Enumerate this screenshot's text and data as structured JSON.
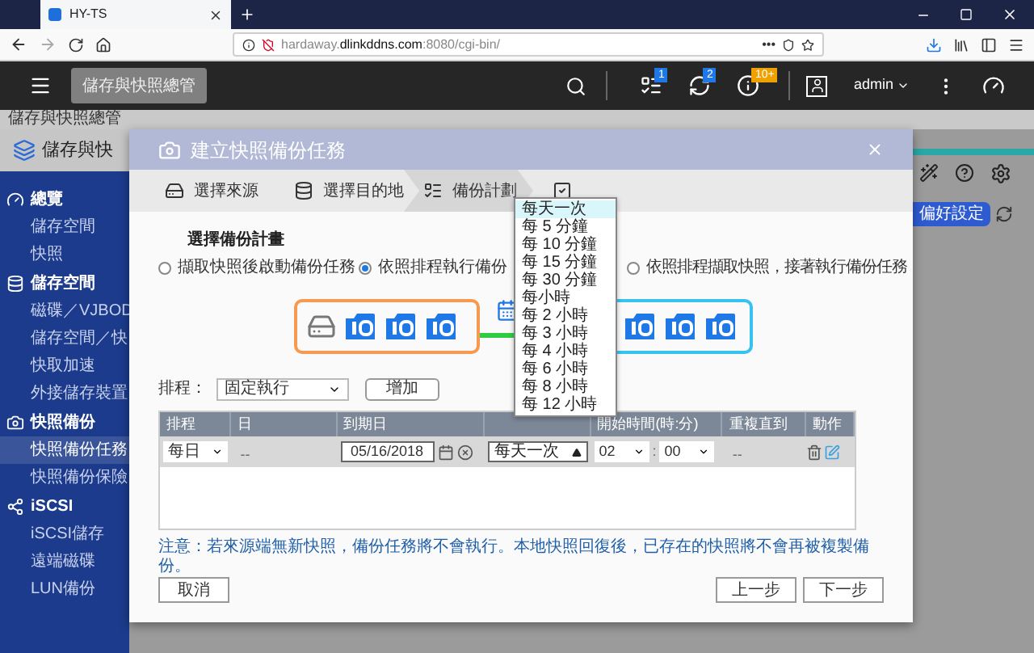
{
  "browser": {
    "tab": {
      "title": "HY-TS"
    },
    "url": {
      "prefix": "hardaway.",
      "host": "dlinkddns.com",
      "suffix": ":8080/cgi-bin/"
    },
    "page_actions": "•••"
  },
  "app_bar": {
    "app_tab": "儲存與快照總管",
    "badges": [
      {
        "text": "1",
        "color": "#1e78e6"
      },
      {
        "text": "2",
        "color": "#1e78e6"
      },
      {
        "text": "10+",
        "color": "#f0a000"
      }
    ],
    "user": "admin"
  },
  "breadcrumb": "儲存與快照總管",
  "sidebar": {
    "header": "儲存與快",
    "groups": [
      {
        "label": "總覽",
        "items": [
          {
            "label": "儲存空間",
            "selected": false
          },
          {
            "label": "快照",
            "selected": false
          }
        ]
      },
      {
        "label": "儲存空間",
        "items": [
          {
            "label": "磁碟／VJBOD",
            "selected": false
          },
          {
            "label": "儲存空間／快",
            "selected": false
          },
          {
            "label": "快取加速",
            "selected": false
          },
          {
            "label": "外接儲存裝置",
            "selected": false
          }
        ]
      },
      {
        "label": "快照備份",
        "items": [
          {
            "label": "快照備份任務",
            "selected": true
          },
          {
            "label": "快照備份保險",
            "selected": false
          }
        ]
      },
      {
        "label": "iSCSI",
        "items": [
          {
            "label": "iSCSI儲存",
            "selected": false
          },
          {
            "label": "遠端磁碟",
            "selected": false
          },
          {
            "label": "LUN備份",
            "selected": false
          }
        ]
      }
    ]
  },
  "right_panel": {
    "button": "偏好設定"
  },
  "dialog": {
    "title": "建立快照備份任務",
    "steps": [
      {
        "label": "選擇來源",
        "selected": false
      },
      {
        "label": "選擇目的地",
        "selected": false
      },
      {
        "label": "備份計劃",
        "selected": true
      },
      {
        "selected": false
      }
    ],
    "section_title": "選擇備份計畫",
    "options": [
      {
        "label": "擷取快照後啟動備份任務",
        "selected": false
      },
      {
        "label": "依照排程執行備份",
        "selected": true
      },
      {
        "label": "依照排程擷取快照，接著執行備份任務",
        "selected": false
      }
    ],
    "schedule": {
      "label": "排程：",
      "value": "固定執行",
      "add_button": "增加"
    },
    "table": {
      "columns": [
        "排程",
        "日",
        "到期日",
        "開始時間(時:分)",
        "重複直到",
        "動作"
      ],
      "rows": [
        {
          "schedule": "每日",
          "day": "--",
          "expiry": "05/16/2018",
          "frequency": "每天一次",
          "hour": "02",
          "separator": ":",
          "minute": "00",
          "repeat_until": "--"
        }
      ]
    },
    "dropdown": {
      "items": [
        {
          "label": "每天一次",
          "selected": true
        },
        {
          "label": "每 5 分鐘",
          "selected": false
        },
        {
          "label": "每 10 分鐘",
          "selected": false
        },
        {
          "label": "每 15 分鐘",
          "selected": false
        },
        {
          "label": "每 30 分鐘",
          "selected": false
        },
        {
          "label": "每小時",
          "selected": false
        },
        {
          "label": "每 2 小時",
          "selected": false
        },
        {
          "label": "每 3 小時",
          "selected": false
        },
        {
          "label": "每 4 小時",
          "selected": false
        },
        {
          "label": "每 6 小時",
          "selected": false
        },
        {
          "label": "每 8 小時",
          "selected": false
        },
        {
          "label": "每 12 小時",
          "selected": false
        }
      ]
    },
    "note": "注意：若來源端無新快照，備份任務將不會執行。本地快照回復後，已存在的快照將不會再被複製備份。",
    "buttons": {
      "cancel": "取消",
      "back": "上一步",
      "next": "下一步"
    }
  }
}
